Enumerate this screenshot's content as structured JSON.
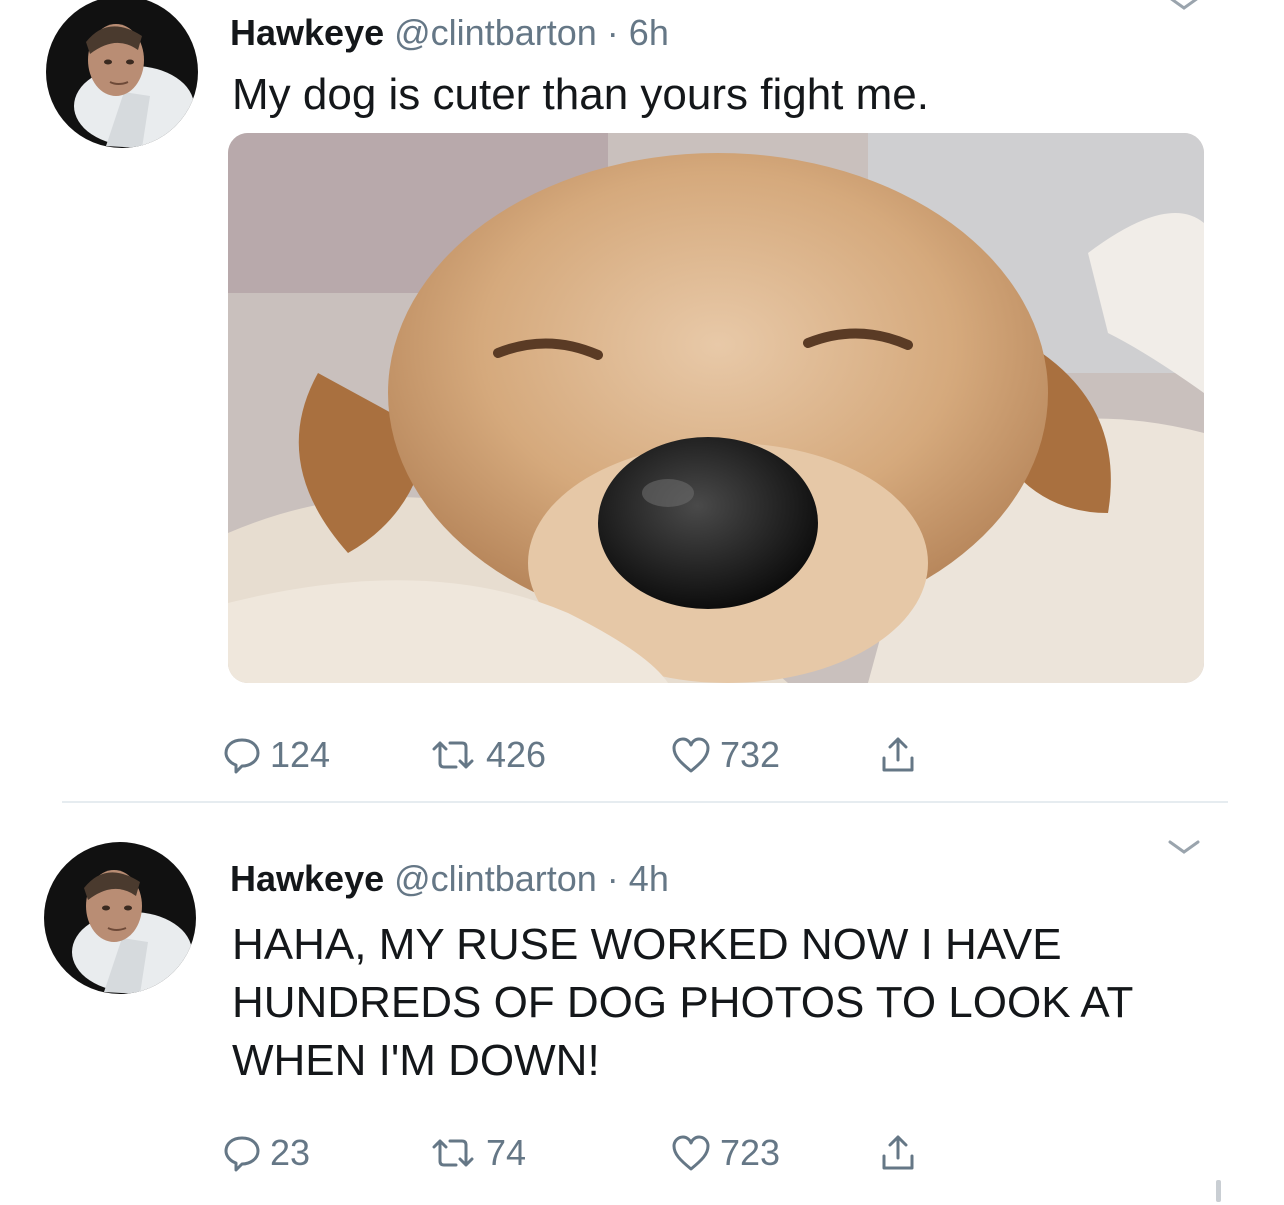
{
  "tweets": [
    {
      "author": {
        "name": "Hawkeye",
        "handle": "@clintbarton",
        "separator": "·",
        "time": "6h"
      },
      "text": "My dog is cuter than yours fight me.",
      "media": {
        "description_icon": "dog-photo"
      },
      "stats": {
        "replies": "124",
        "retweets": "426",
        "likes": "732"
      },
      "icons": {
        "avatar": "avatar-photo",
        "reply": "reply-icon",
        "retweet": "retweet-icon",
        "like": "heart-icon",
        "share": "share-icon",
        "menu": "chevron-down-icon"
      }
    },
    {
      "author": {
        "name": "Hawkeye",
        "handle": "@clintbarton",
        "separator": "·",
        "time": "4h"
      },
      "text": "HAHA, MY RUSE WORKED NOW I HAVE HUNDREDS OF DOG PHOTOS TO LOOK AT WHEN I'M DOWN!",
      "stats": {
        "replies": "23",
        "retweets": "74",
        "likes": "723"
      },
      "icons": {
        "avatar": "avatar-photo",
        "reply": "reply-icon",
        "retweet": "retweet-icon",
        "like": "heart-icon",
        "share": "share-icon",
        "menu": "chevron-down-icon"
      }
    }
  ],
  "colors": {
    "text": "#14171a",
    "secondary": "#657786",
    "divider": "#e6ecf0"
  }
}
